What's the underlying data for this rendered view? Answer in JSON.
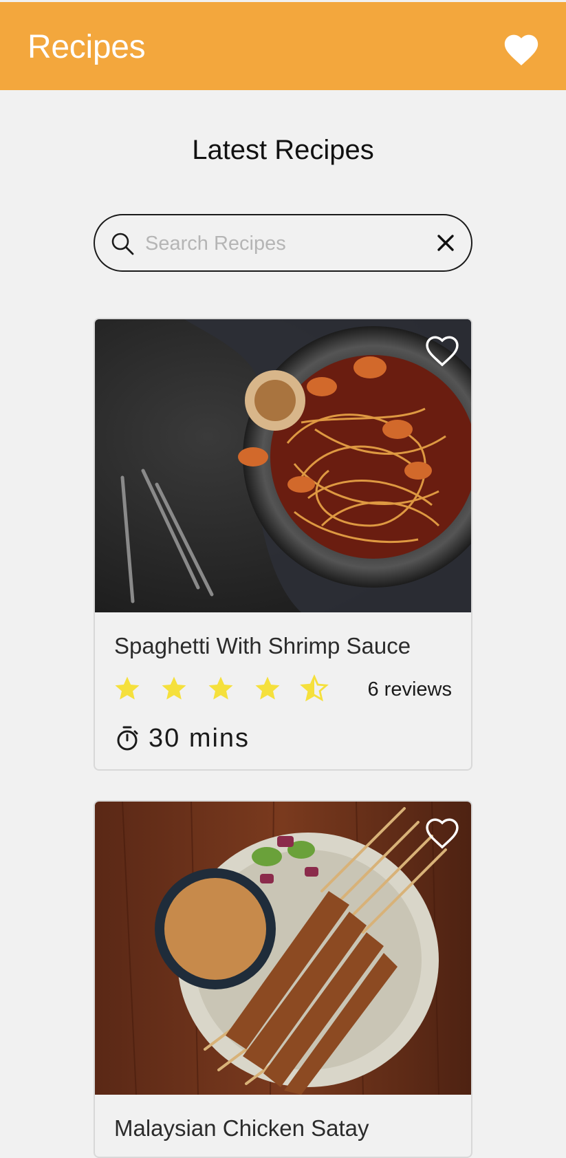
{
  "app_bar": {
    "title": "Recipes",
    "favorites_icon": "heart-filled-icon",
    "background_color": "#f3a73d"
  },
  "page": {
    "title": "Latest Recipes"
  },
  "search": {
    "placeholder": "Search Recipes",
    "value": "",
    "icon": "search-icon",
    "clear_icon": "close-icon"
  },
  "recipes": [
    {
      "title": "Spaghetti With Shrimp Sauce",
      "rating": 4.5,
      "rating_max": 5,
      "reviews": "6 reviews",
      "time": "30 mins",
      "image": "spaghetti with shrimp on dark plate",
      "favorite": false
    },
    {
      "title": "Malaysian Chicken Satay",
      "image": "chicken satay skewers with peanut sauce",
      "favorite": false
    }
  ],
  "colors": {
    "accent": "#f3a73d",
    "star": "#f5e03c",
    "background": "#f1f1f1"
  }
}
